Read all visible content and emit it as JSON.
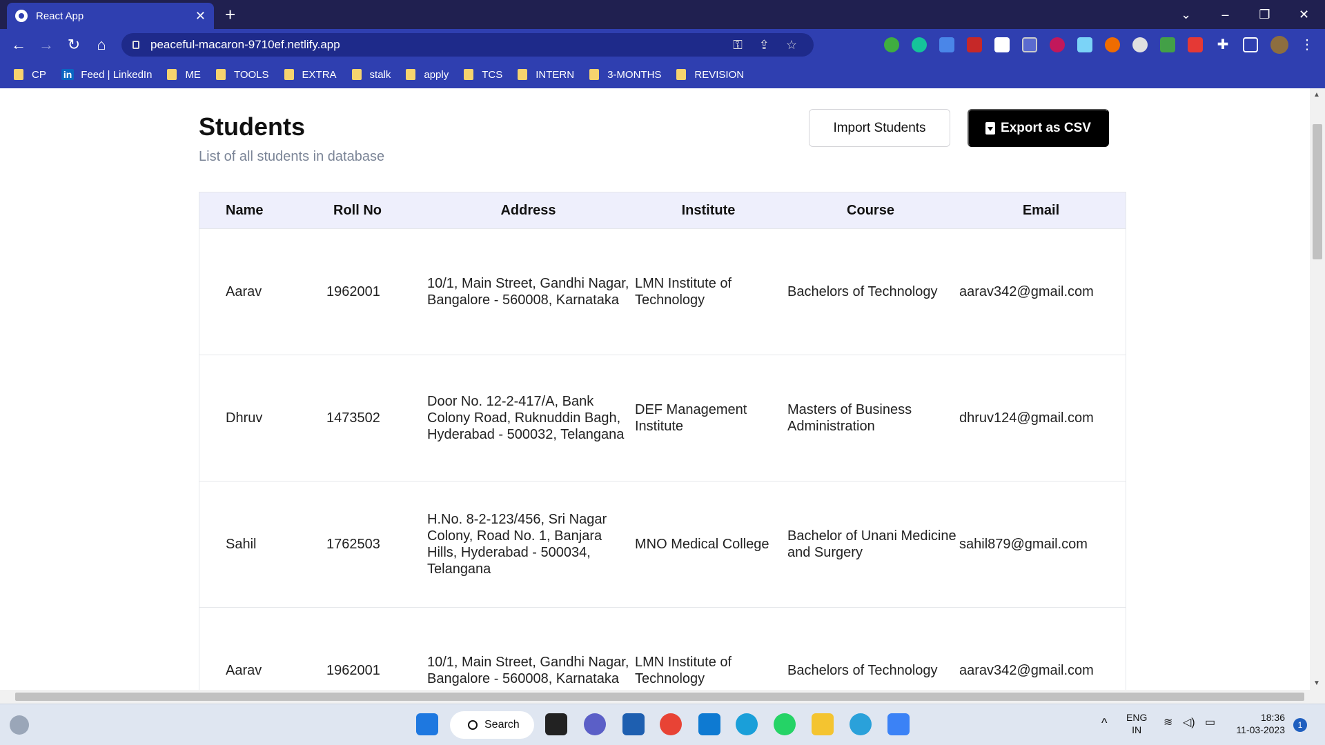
{
  "browser": {
    "tab_title": "React App",
    "url": "peaceful-macaron-9710ef.netlify.app",
    "bookmarks": [
      "CP",
      "Feed | LinkedIn",
      "ME",
      "TOOLS",
      "EXTRA",
      "stalk",
      "apply",
      "TCS",
      "INTERN",
      "3-MONTHS",
      "REVISION"
    ]
  },
  "page": {
    "title": "Students",
    "subtitle": "List of all students in database",
    "import_label": "Import Students",
    "export_label": "Export as CSV"
  },
  "table": {
    "headers": [
      "Name",
      "Roll No",
      "Address",
      "Institute",
      "Course",
      "Email"
    ],
    "rows": [
      {
        "name": "Aarav",
        "roll": "1962001",
        "address": "10/1, Main Street, Gandhi Nagar, Bangalore - 560008, Karnataka",
        "institute": "LMN Institute of Technology",
        "course": "Bachelors of Technology",
        "email": "aarav342@gmail.com"
      },
      {
        "name": "Dhruv",
        "roll": "1473502",
        "address": "Door No. 12-2-417/A, Bank Colony Road, Ruknuddin Bagh, Hyderabad - 500032, Telangana",
        "institute": "DEF Management Institute",
        "course": "Masters of Business Administration",
        "email": "dhruv124@gmail.com"
      },
      {
        "name": "Sahil",
        "roll": "1762503",
        "address": "H.No. 8-2-123/456, Sri Nagar Colony, Road No. 1, Banjara Hills, Hyderabad - 500034, Telangana",
        "institute": "MNO Medical College",
        "course": "Bachelor of Unani Medicine and Surgery",
        "email": "sahil879@gmail.com"
      },
      {
        "name": "Aarav",
        "roll": "1962001",
        "address": "10/1, Main Street, Gandhi Nagar, Bangalore - 560008, Karnataka",
        "institute": "LMN Institute of Technology",
        "course": "Bachelors of Technology",
        "email": "aarav342@gmail.com"
      }
    ]
  },
  "taskbar": {
    "search_label": "Search",
    "lang": "ENG",
    "region": "IN",
    "time": "18:36",
    "date": "11-03-2023",
    "notification_count": "1"
  },
  "colors": {
    "tab_strip": "#202050",
    "toolbar": "#2f3fb0",
    "table_header_bg": "#eeeffc",
    "export_button": "#000000"
  }
}
